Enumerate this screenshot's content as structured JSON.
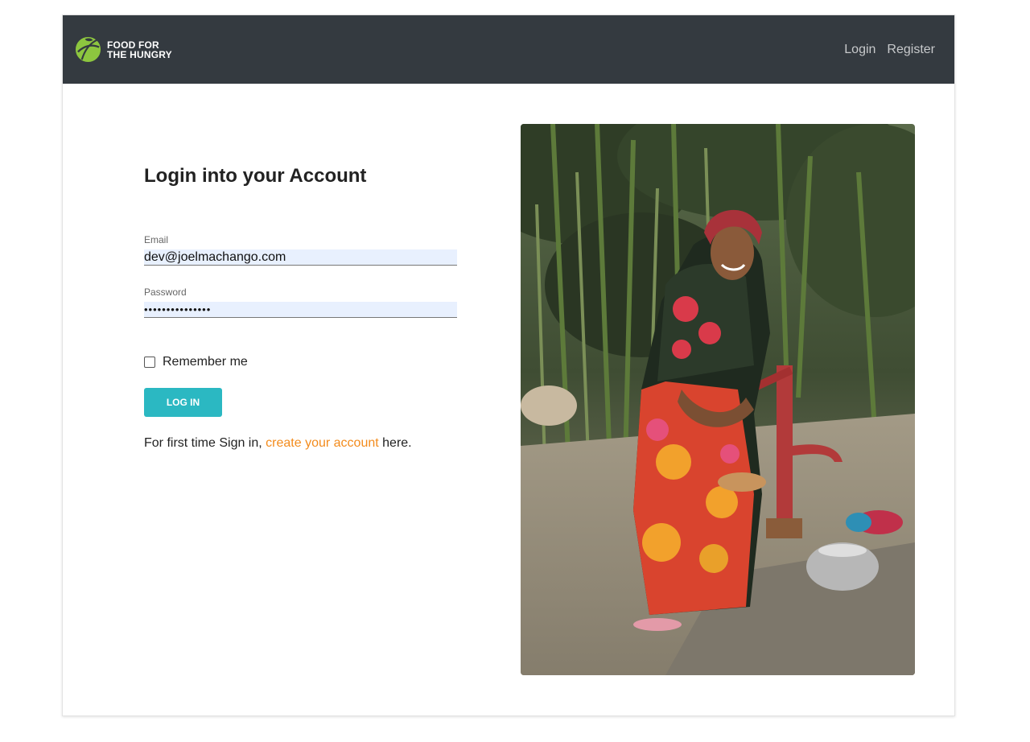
{
  "brand": {
    "line1": "FOOD FOR",
    "line2": "THE HUNGRY",
    "logo_icon": "leaf-circle-icon",
    "accent": "#8dc63f"
  },
  "nav": {
    "login": "Login",
    "register": "Register"
  },
  "form": {
    "title": "Login into your Account",
    "email_label": "Email",
    "email_value": "dev@joelmachango.com",
    "password_label": "Password",
    "password_value": "•••••••••••••••",
    "remember_label": "Remember me",
    "login_button": "LOG IN",
    "signup_prefix": "For first time Sign in,",
    "signup_link": "create your account",
    "signup_suffix": "here."
  },
  "colors": {
    "navbar": "#343a40",
    "button": "#2bb8c2",
    "link": "#f38b1c",
    "input_bg": "#e8f0fe"
  },
  "photo": {
    "icon": "photo-woman-water-pump-image"
  }
}
